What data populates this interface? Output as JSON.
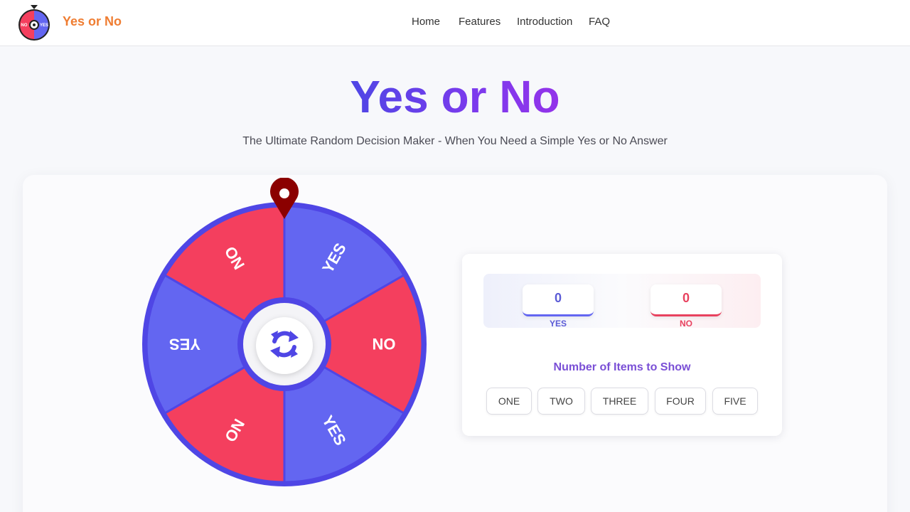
{
  "header": {
    "brand": "Yes or No",
    "logo": {
      "left_label": "NO",
      "right_label": "YES",
      "colors": {
        "no": "#f43f5e",
        "yes": "#6366f1"
      }
    },
    "nav": [
      "Home",
      "Features",
      "Introduction",
      "FAQ"
    ]
  },
  "hero": {
    "title": "Yes or No",
    "subtitle": "The Ultimate Random Decision Maker - When You Need a Simple Yes or No Answer"
  },
  "wheel": {
    "segments": [
      "YES",
      "NO",
      "YES",
      "NO",
      "YES",
      "NO"
    ],
    "colors": {
      "yes": "#6366f1",
      "no": "#f43f5e",
      "rim": "#4f46e5",
      "pointer": "#8b0000"
    },
    "spin_icon": "refresh-icon"
  },
  "score": {
    "yes_count": "0",
    "yes_label": "YES",
    "no_count": "0",
    "no_label": "NO"
  },
  "items": {
    "heading": "Number of Items to Show",
    "options": [
      "ONE",
      "TWO",
      "THREE",
      "FOUR",
      "FIVE"
    ]
  }
}
